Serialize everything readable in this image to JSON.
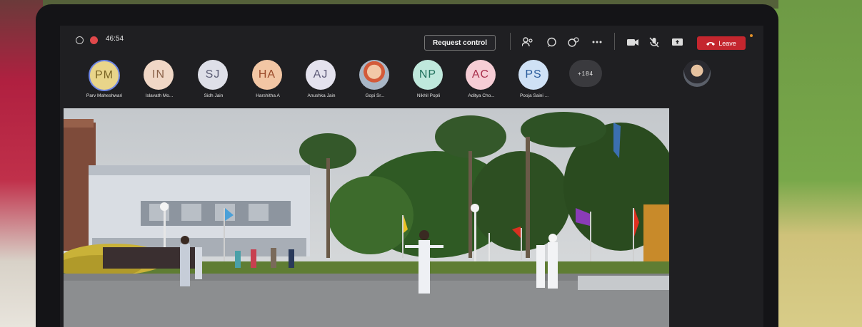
{
  "meeting": {
    "timer": "46:54",
    "request_control_label": "Request control",
    "leave_label": "Leave",
    "toolbar_icons": [
      "participants-icon",
      "chat-icon",
      "reactions-icon",
      "more-icon",
      "camera-icon",
      "mic-off-icon",
      "share-icon"
    ]
  },
  "participants": [
    {
      "initials": "PM",
      "name": "Parv Maheshwari",
      "bg": "#e9d58a",
      "fg": "#7a6424",
      "ring": "#6e86e6"
    },
    {
      "initials": "IN",
      "name": "Islavath Mo...",
      "bg": "#f0d7c6",
      "fg": "#8a6048"
    },
    {
      "initials": "SJ",
      "name": "Sidh Jain",
      "bg": "#dedfe8",
      "fg": "#5a5c74"
    },
    {
      "initials": "HA",
      "name": "Harshitha A",
      "bg": "#f2c6a4",
      "fg": "#9a4a2a"
    },
    {
      "initials": "AJ",
      "name": "Anushka Jain",
      "bg": "#e4e2ee",
      "fg": "#5d5a78"
    },
    {
      "initials": "",
      "name": "Gopi Sr...",
      "photo": true
    },
    {
      "initials": "NP",
      "name": "Nikhil Popli",
      "bg": "#bfe8dc",
      "fg": "#23725e"
    },
    {
      "initials": "AC",
      "name": "Aditya Cho...",
      "bg": "#f6cdd5",
      "fg": "#a8304c"
    },
    {
      "initials": "PS",
      "name": "Pooja Saini ...",
      "bg": "#cfe1f5",
      "fg": "#2a5c9c"
    },
    {
      "initials": "+184",
      "name": "",
      "bg": "#3a3a3e",
      "fg": "#e6e6e6"
    }
  ]
}
